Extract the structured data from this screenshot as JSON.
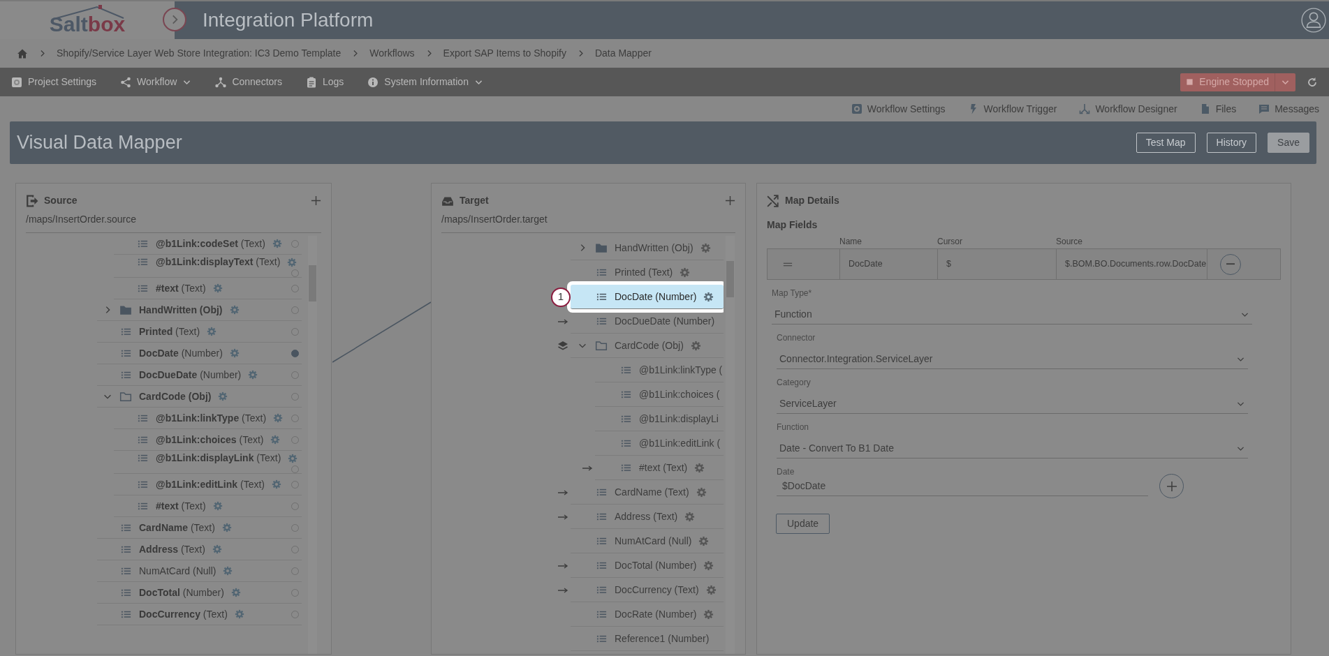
{
  "header": {
    "logo": [
      "Salt",
      "box"
    ],
    "title": "Integration Platform"
  },
  "breadcrumb": [
    "Shopify/Service Layer Web Store Integration: IC3 Demo Template",
    "Workflows",
    "Export SAP Items to Shopify",
    "Data Mapper"
  ],
  "nav": [
    {
      "label": "Project Settings",
      "dropdown": false
    },
    {
      "label": "Workflow",
      "dropdown": true
    },
    {
      "label": "Connectors",
      "dropdown": false
    },
    {
      "label": "Logs",
      "dropdown": false
    },
    {
      "label": "System Information",
      "dropdown": true
    }
  ],
  "engine": {
    "label": "Engine Stopped"
  },
  "toolbar": [
    {
      "label": "Workflow Settings"
    },
    {
      "label": "Workflow Trigger"
    },
    {
      "label": "Workflow Designer"
    },
    {
      "label": "Files"
    },
    {
      "label": "Messages"
    }
  ],
  "page_title": "Visual Data Mapper",
  "title_buttons": [
    {
      "label": "Test Map",
      "disabled": false
    },
    {
      "label": "History",
      "disabled": false
    },
    {
      "label": "Save",
      "disabled": true
    }
  ],
  "source": {
    "title": "Source",
    "path": "/maps/InsertOrder.source",
    "tree": [
      {
        "kind": "offscreen_parent",
        "children": [
          {
            "kind": "field",
            "label": "**@b1Link:codeSet** (Text)",
            "selected": false
          },
          {
            "kind": "field",
            "label": "**@b1Link:displayText** (Text)",
            "selected": false
          },
          {
            "kind": "field",
            "label": "**#text** (Text)",
            "selected": false
          }
        ]
      },
      {
        "kind": "object",
        "label": "**HandWritten (Obj)**",
        "expanded": false,
        "selected": false
      },
      {
        "kind": "field",
        "label": "**Printed** (Text)",
        "selected": false
      },
      {
        "kind": "field",
        "label": "**DocDate** (Number)",
        "selected": true
      },
      {
        "kind": "field",
        "label": "**DocDueDate** (Number)",
        "selected": false
      },
      {
        "kind": "object",
        "label": "**CardCode (Obj)**",
        "expanded": true,
        "selected": false,
        "children": [
          {
            "kind": "field",
            "label": "**@b1Link:linkType** (Text)",
            "selected": false
          },
          {
            "kind": "field",
            "label": "**@b1Link:choices** (Text)",
            "selected": false
          },
          {
            "kind": "field",
            "label": "**@b1Link:displayLink** (Text)",
            "selected": false
          },
          {
            "kind": "field",
            "label": "**@b1Link:editLink** (Text)",
            "selected": false
          },
          {
            "kind": "field",
            "label": "**#text** (Text)",
            "selected": false
          }
        ]
      },
      {
        "kind": "field",
        "label": "**CardName** (Text)",
        "selected": false
      },
      {
        "kind": "field",
        "label": "**Address** (Text)",
        "selected": false
      },
      {
        "kind": "field",
        "label": "NumAtCard (Null)",
        "selected": false
      },
      {
        "kind": "field",
        "label": "**DocTotal** (Number)",
        "selected": false
      },
      {
        "kind": "field",
        "label": "**DocCurrency** (Text)",
        "selected": false
      }
    ]
  },
  "target": {
    "title": "Target",
    "path": "/maps/InsertOrder.target",
    "step_number": "1",
    "tree": [
      {
        "kind": "object",
        "label": "HandWritten (Obj)",
        "expanded": false,
        "selected": false
      },
      {
        "kind": "field",
        "label": "Printed (Text)",
        "selected": false
      },
      {
        "kind": "field",
        "label": "DocDate (Number)",
        "selected": true
      },
      {
        "kind": "field",
        "label": "DocDueDate (Number)",
        "selected": false,
        "mapped": true
      },
      {
        "kind": "object",
        "label": "CardCode (Obj)",
        "expanded": true,
        "selected": false,
        "nested_mapping": true,
        "children": [
          {
            "kind": "field",
            "label": "@b1Link:linkType (",
            "selected": false
          },
          {
            "kind": "field",
            "label": "@b1Link:choices (",
            "selected": false
          },
          {
            "kind": "field",
            "label": "@b1Link:displayLi",
            "selected": false
          },
          {
            "kind": "field",
            "label": "@b1Link:editLink (",
            "selected": false
          },
          {
            "kind": "field",
            "label": "#text (Text)",
            "selected": false,
            "mapped": true
          }
        ]
      },
      {
        "kind": "field",
        "label": "CardName (Text)",
        "selected": false,
        "mapped": true
      },
      {
        "kind": "field",
        "label": "Address (Text)",
        "selected": false,
        "mapped": true
      },
      {
        "kind": "field",
        "label": "NumAtCard (Null)",
        "selected": false
      },
      {
        "kind": "field",
        "label": "DocTotal (Number)",
        "selected": false,
        "mapped": true
      },
      {
        "kind": "field",
        "label": "DocCurrency (Text)",
        "selected": false,
        "mapped": true
      },
      {
        "kind": "field",
        "label": "DocRate (Number)",
        "selected": false
      },
      {
        "kind": "field",
        "label": "Reference1 (Number)",
        "selected": false
      }
    ]
  },
  "map_details": {
    "title": "Map Details",
    "section": "Map Fields",
    "columns": [
      "Name",
      "Cursor",
      "Source"
    ],
    "row": {
      "name": "DocDate",
      "cursor": "$",
      "source": "$.BOM.BO.Documents.row.DocDate"
    },
    "map_type": {
      "label": "Map Type*",
      "value": "Function"
    },
    "fields": [
      {
        "kind": "select",
        "label": "Connector",
        "value": "Connector.Integration.ServiceLayer"
      },
      {
        "kind": "select",
        "label": "Category",
        "value": "ServiceLayer"
      },
      {
        "kind": "select",
        "label": "Function",
        "value": "Date - Convert To B1 Date"
      },
      {
        "kind": "input",
        "label": "Date",
        "value": "$DocDate"
      }
    ],
    "update_button": "Update"
  }
}
